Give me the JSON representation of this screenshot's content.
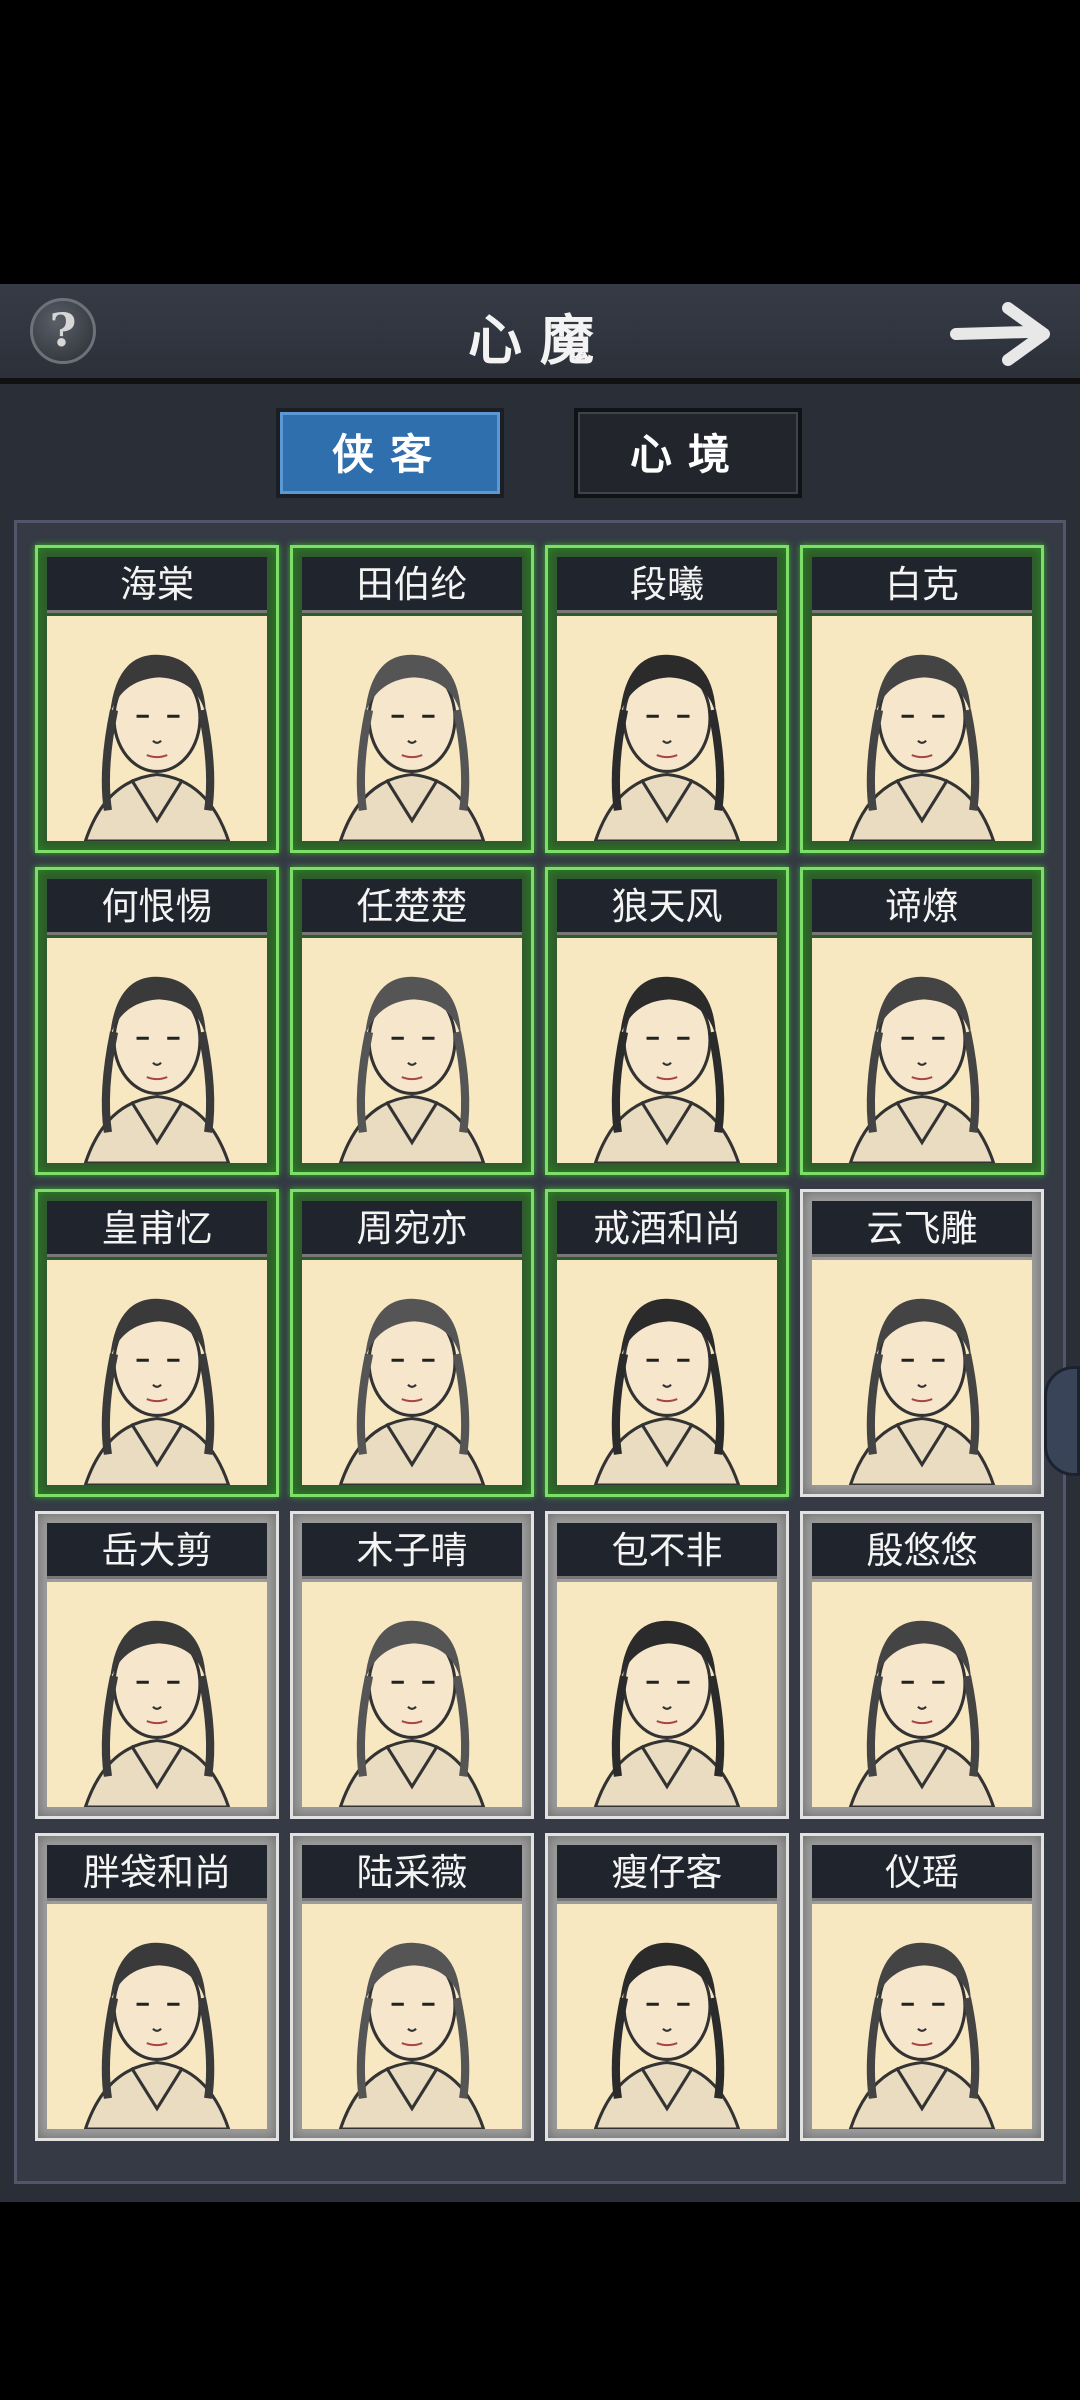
{
  "header": {
    "help_icon": "?",
    "title": "心魔",
    "next_icon": "arrow-right-icon"
  },
  "tabs": [
    {
      "label": "侠客",
      "active": true
    },
    {
      "label": "心境",
      "active": false
    }
  ],
  "colors": {
    "panel": "#2a2e37",
    "tab_active": "#2f6fad",
    "card_unlocked_border": "#7ede6a",
    "card_locked_border": "#e2e2e2",
    "portrait_bg": "#f7e8c2"
  },
  "characters": [
    {
      "name": "海棠",
      "unlocked": true
    },
    {
      "name": "田伯纶",
      "unlocked": true
    },
    {
      "name": "段曦",
      "unlocked": true
    },
    {
      "name": "白克",
      "unlocked": true
    },
    {
      "name": "何恨惕",
      "unlocked": true
    },
    {
      "name": "任楚楚",
      "unlocked": true
    },
    {
      "name": "狼天风",
      "unlocked": true
    },
    {
      "name": "谛燎",
      "unlocked": true
    },
    {
      "name": "皇甫忆",
      "unlocked": true
    },
    {
      "name": "周宛亦",
      "unlocked": true
    },
    {
      "name": "戒酒和尚",
      "unlocked": true
    },
    {
      "name": "云飞雕",
      "unlocked": false
    },
    {
      "name": "岳大剪",
      "unlocked": false
    },
    {
      "name": "木子晴",
      "unlocked": false
    },
    {
      "name": "包不非",
      "unlocked": false
    },
    {
      "name": "殷悠悠",
      "unlocked": false
    },
    {
      "name": "胖袋和尚",
      "unlocked": false
    },
    {
      "name": "陆采薇",
      "unlocked": false
    },
    {
      "name": "瘦仔客",
      "unlocked": false
    },
    {
      "name": "仪瑶",
      "unlocked": false
    }
  ]
}
